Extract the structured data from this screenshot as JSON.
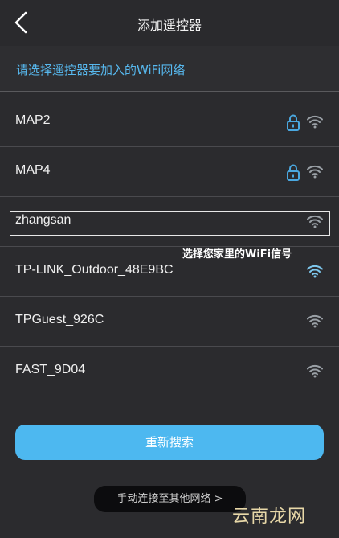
{
  "header": {
    "title": "添加遥控器",
    "back_icon": "chevron-left-icon"
  },
  "subtitle": "请选择遥控器要加入的WiFi网络",
  "networks": [
    {
      "ssid": "MAP2",
      "locked": true,
      "selected": false
    },
    {
      "ssid": "MAP4",
      "locked": true,
      "selected": false
    },
    {
      "ssid": "zhangsan",
      "locked": false,
      "selected": true
    },
    {
      "ssid": "TP-LINK_Outdoor_48E9BC",
      "locked": false,
      "selected": false
    },
    {
      "ssid": "TPGuest_926C",
      "locked": false,
      "selected": false
    },
    {
      "ssid": "FAST_9D04",
      "locked": false,
      "selected": false
    }
  ],
  "annotation": "选择您家里的WiFi信号",
  "refresh_button": "重新搜索",
  "manual_link": "手动连接至其他网络 >",
  "watermark": "云南龙网",
  "colors": {
    "accent": "#4db8f0",
    "subtitle": "#57b8ee",
    "background": "#2b2b2e",
    "lock": "#4aa8e0",
    "wifi_secured": "#9aa0a6",
    "wifi_open": "#7ec8ee"
  }
}
